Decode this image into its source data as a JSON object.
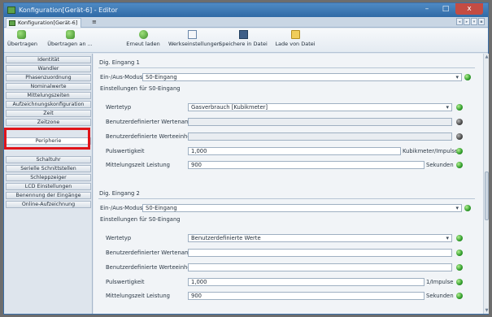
{
  "window": {
    "title": "Konfiguration[Gerät-6] - Editor",
    "controls": {
      "minimize": "–",
      "maximize": "□",
      "close": "x"
    }
  },
  "tab": {
    "label": "Konfiguration[Gerät-6]",
    "pin": "≡"
  },
  "tab_nav": [
    "◂",
    "▸",
    "▾",
    "▪"
  ],
  "toolbar": {
    "items": [
      {
        "label": "Übertragen",
        "icon": "green-transfer-icon"
      },
      {
        "label": "Übertragen an ...",
        "icon": "green-transfer-to-icon"
      },
      {
        "label": "Erneut laden",
        "icon": "refresh-icon"
      },
      {
        "label": "Werkseinstellungen",
        "icon": "document-icon"
      },
      {
        "label": "Speichere in Datei",
        "icon": "save-icon"
      },
      {
        "label": "Lade von Datei",
        "icon": "folder-icon"
      }
    ]
  },
  "sidebar": {
    "items": [
      {
        "label": "Identität"
      },
      {
        "label": "Wandler"
      },
      {
        "label": "Phasenzuordnung"
      },
      {
        "label": "Nominalwerte"
      },
      {
        "label": "Mittelungszeiten"
      },
      {
        "label": "Aufzeichnungskonfiguration"
      },
      {
        "label": "Zeit"
      },
      {
        "label": "Zeitzone"
      },
      {
        "label": "Peripherie"
      },
      {
        "label": "Schaltuhr"
      },
      {
        "label": "Serielle Schnittstellen"
      },
      {
        "label": "Schleppzeiger"
      },
      {
        "label": "LCD Einstellungen"
      },
      {
        "label": "Benennung der Eingänge"
      },
      {
        "label": "Online-Aufzeichnung"
      }
    ],
    "active": "Peripherie"
  },
  "groups": [
    {
      "title": "Dig. Eingang 1",
      "mode_label": "Ein-/Aus-Modus",
      "mode_value": "S0-Eingang",
      "subtitle": "Einstellungen für S0-Eingang",
      "rows": [
        {
          "label": "Wertetyp",
          "value": "Gasverbrauch [Kubikmeter]",
          "unit": "",
          "status": "green"
        },
        {
          "label": "Benutzerdefinierter Wertename",
          "value": "",
          "unit": "",
          "status": "gray"
        },
        {
          "label": "Benutzerdefinierte Werteeinheit",
          "value": "",
          "unit": "",
          "status": "gray"
        },
        {
          "label": "Pulswertigkeit",
          "value": "1,000",
          "unit": "Kubikmeter/Impulse",
          "status": "green"
        },
        {
          "label": "Mittelungszeit Leistung",
          "value": "900",
          "unit": "Sekunden",
          "status": "green"
        }
      ]
    },
    {
      "title": "Dig. Eingang 2",
      "mode_label": "Ein-/Aus-Modus",
      "mode_value": "S0-Eingang",
      "subtitle": "Einstellungen für S0-Eingang",
      "rows": [
        {
          "label": "Wertetyp",
          "value": "Benutzerdefinierte Werte",
          "unit": "",
          "status": "green"
        },
        {
          "label": "Benutzerdefinierter Wertename",
          "value": "",
          "unit": "",
          "status": "green"
        },
        {
          "label": "Benutzerdefinierte Werteeinheit",
          "value": "",
          "unit": "",
          "status": "green"
        },
        {
          "label": "Pulswertigkeit",
          "value": "1,000",
          "unit": "1/Impulse",
          "status": "green"
        },
        {
          "label": "Mittelungszeit Leistung",
          "value": "900",
          "unit": "Sekunden",
          "status": "green"
        }
      ]
    }
  ],
  "scrollbar": {
    "up": "▲",
    "down": "▼"
  },
  "colors": {
    "status_green": "#2f9c2a",
    "status_gray": "#4a4a4a",
    "highlight": "#e0141a"
  }
}
